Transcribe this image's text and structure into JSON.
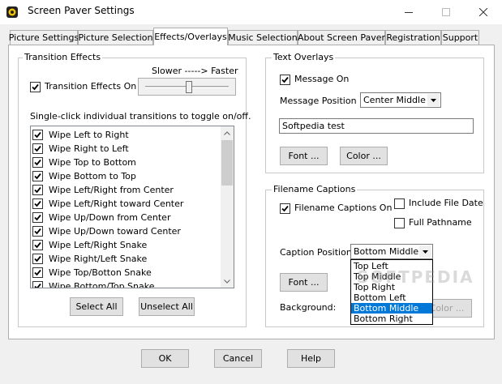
{
  "window": {
    "title": "Screen Paver Settings"
  },
  "tabs": [
    {
      "label": "Picture Settings"
    },
    {
      "label": "Picture Selection"
    },
    {
      "label": "Effects/Overlays"
    },
    {
      "label": "Music Selection"
    },
    {
      "label": "About Screen Paver"
    },
    {
      "label": "Registration"
    },
    {
      "label": "Support"
    }
  ],
  "transition": {
    "group_label": "Transition Effects",
    "enabled_label": "Transition Effects On",
    "enabled": true,
    "speed_label": "Slower -----> Faster",
    "speed_value": 0.52,
    "hint": "Single-click individual transitions to toggle on/off.",
    "items": [
      {
        "label": "Wipe Left to Right",
        "checked": true
      },
      {
        "label": "Wipe Right to Left",
        "checked": true
      },
      {
        "label": "Wipe Top to Bottom",
        "checked": true
      },
      {
        "label": "Wipe Bottom to Top",
        "checked": true
      },
      {
        "label": "Wipe Left/Right from Center",
        "checked": true
      },
      {
        "label": "Wipe Left/Right toward Center",
        "checked": true
      },
      {
        "label": "Wipe Up/Down from Center",
        "checked": true
      },
      {
        "label": "Wipe Up/Down toward Center",
        "checked": true
      },
      {
        "label": "Wipe Left/Right Snake",
        "checked": true
      },
      {
        "label": "Wipe Right/Left Snake",
        "checked": true
      },
      {
        "label": "Wipe Top/Botton Snake",
        "checked": true
      },
      {
        "label": "Wipe Bottom/Top Snake",
        "checked": true
      }
    ],
    "select_all": "Select All",
    "unselect_all": "Unselect All"
  },
  "text_overlays": {
    "group_label": "Text Overlays",
    "message_on_label": "Message On",
    "message_on": true,
    "position_label": "Message Position",
    "position_value": "Center Middle",
    "message_text": "Softpedia test",
    "font_button": "Font ...",
    "color_button": "Color ..."
  },
  "captions": {
    "group_label": "Filename Captions",
    "on_label": "Filename Captions On",
    "on": true,
    "include_date_label": "Include File Date",
    "include_date": false,
    "full_path_label": "Full Pathname",
    "full_path": false,
    "position_label": "Caption Position",
    "position_value": "Bottom Middle",
    "options": [
      "Top Left",
      "Top Middle",
      "Top Right",
      "Bottom Left",
      "Bottom Middle",
      "Bottom Right"
    ],
    "selected_index": 4,
    "font_button": "Font ...",
    "background_label": "Background:",
    "color_button": "Color ..."
  },
  "footer": {
    "ok": "OK",
    "cancel": "Cancel",
    "help": "Help"
  },
  "watermark": "SOFTPEDIA"
}
